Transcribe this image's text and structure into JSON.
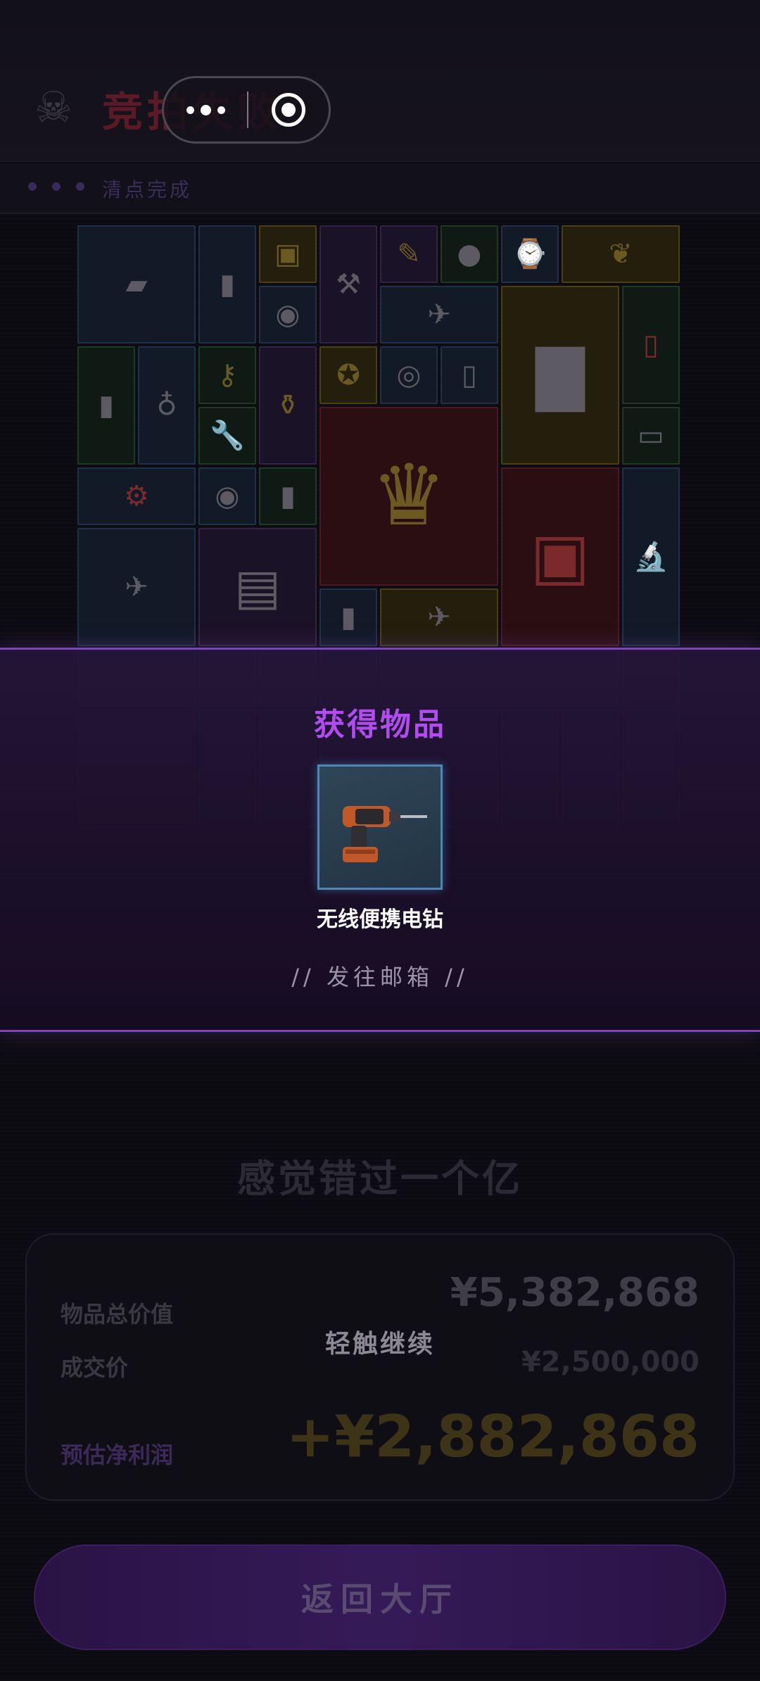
{
  "header": {
    "title": "竞拍失败",
    "status_text": "清点完成",
    "skull_icon": "skull-icon"
  },
  "overlay": {
    "title": "获得物品",
    "item_name": "无线便携电钻",
    "mailbox_text": "// 发往邮箱 //"
  },
  "result": {
    "missed_text": "感觉错过一个亿",
    "total_value_label": "物品总价值",
    "total_value": "¥5,382,868",
    "deal_price_label": "成交价",
    "deal_price": "¥2,500,000",
    "profit_label": "预估净利润",
    "profit": "+¥2,882,868",
    "tap_continue": "轻触继续"
  },
  "back_button": "返回大厅",
  "colors": {
    "accent_purple": "#b24cf0",
    "band_border": "#7b45b8",
    "item_border": "#4f86b8"
  }
}
